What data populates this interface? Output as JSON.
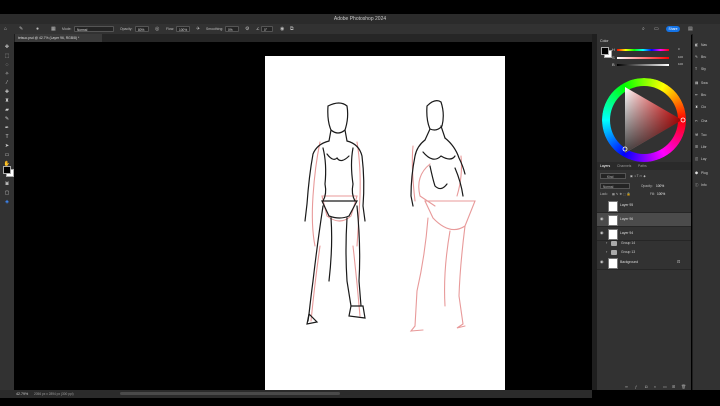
{
  "app": {
    "title": "Adobe Photoshop 2024"
  },
  "options_bar": {
    "mode_label": "Mode:",
    "mode_value": "Normal",
    "opacity_label": "Opacity:",
    "opacity_value": "80%",
    "flow_label": "Flow:",
    "flow_value": "100%",
    "smoothing_label": "Smoothing:",
    "smoothing_value": "0%",
    "angle_value": "0°",
    "share_label": "Share"
  },
  "document": {
    "tab_label": "tetsuo.psd @ 42.7% (Layer 96, RGB/8) *"
  },
  "status": {
    "zoom": "42.79%",
    "doc_info": "2056 px x 2894 px (300 ppi)"
  },
  "color_panel": {
    "label": "Color",
    "hue_value": "0",
    "sat_value": "100",
    "bright_value": "100",
    "fg_color": "#000000",
    "bg_color": "#ffffff"
  },
  "dock": {
    "items": [
      {
        "icon": "book-icon",
        "label": "Nav"
      },
      {
        "icon": "brush-icon",
        "label": "Bru"
      },
      {
        "icon": "type-icon",
        "label": "Sty"
      },
      {
        "icon": "doc-icon",
        "label": "Swa"
      },
      {
        "icon": "brush-settings-icon",
        "label": "Bru"
      },
      {
        "icon": "clone-icon",
        "label": "Clo"
      },
      {
        "icon": "channels-icon",
        "label": "Cha"
      },
      {
        "icon": "tool-presets-icon",
        "label": "Too"
      },
      {
        "icon": "libraries-icon",
        "label": "Libr"
      },
      {
        "icon": "layer-comps-icon",
        "label": "Lay"
      },
      {
        "icon": "plugins-icon",
        "label": "Plug"
      },
      {
        "icon": "info-icon",
        "label": "Info"
      }
    ]
  },
  "layers_panel": {
    "tabs": [
      "Layers",
      "Channels",
      "Paths"
    ],
    "kind_label": "Kind",
    "blend_mode": "Normal",
    "opacity_label": "Opacity:",
    "opacity_value": "100%",
    "lock_label": "Lock:",
    "fill_label": "Fill:",
    "fill_value": "100%",
    "layers": [
      {
        "name": "Layer 95",
        "visible": false,
        "selected": false
      },
      {
        "name": "Layer 96",
        "visible": true,
        "selected": true
      },
      {
        "name": "Layer 94",
        "visible": true,
        "selected": false
      }
    ],
    "groups": [
      "Group 14",
      "Group 13"
    ],
    "background": "Background"
  }
}
